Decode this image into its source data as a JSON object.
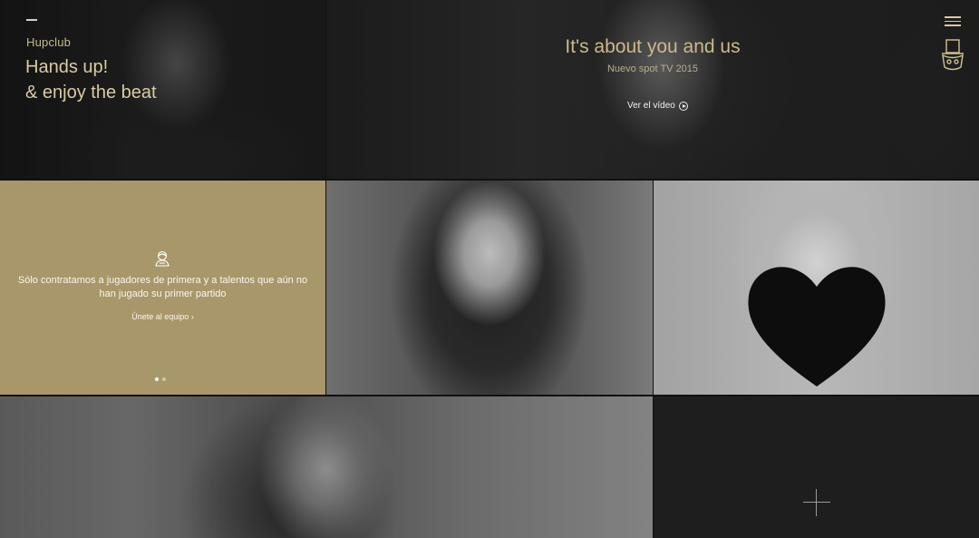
{
  "header": {
    "brand": "Hupclub",
    "tagline_line1": "Hands up!",
    "tagline_line2": "& enjoy the beat"
  },
  "video_tile": {
    "title": "It's about you and us",
    "subtitle": "Nuevo spot TV 2015",
    "link_label": "Ver el vídeo"
  },
  "promo_tile": {
    "text": "Sólo contratamos a jugadores de primera y a talentos que aún no han jugado su primer partido",
    "link_label": "Únete al equipo ›",
    "slides_total": 2,
    "slide_active": 1
  },
  "colors": {
    "gold": "#a8976a",
    "gold_text": "#cdb98a",
    "dark": "#1e1e1e"
  },
  "icons": [
    "menu-icon",
    "hat-logo-icon",
    "player-icon",
    "play-icon",
    "plus-icon"
  ]
}
